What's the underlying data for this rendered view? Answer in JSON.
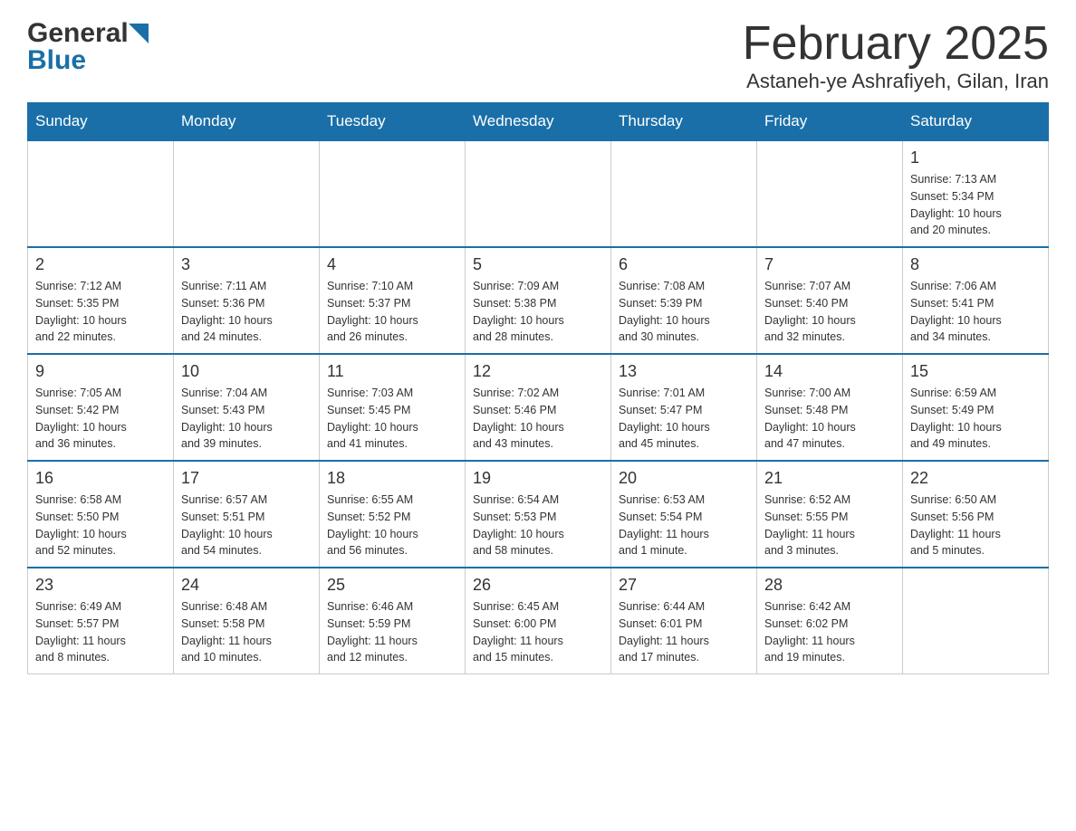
{
  "logo": {
    "general": "General",
    "blue": "Blue"
  },
  "title": "February 2025",
  "subtitle": "Astaneh-ye Ashrafiyeh, Gilan, Iran",
  "days_of_week": [
    "Sunday",
    "Monday",
    "Tuesday",
    "Wednesday",
    "Thursday",
    "Friday",
    "Saturday"
  ],
  "weeks": [
    {
      "cells": [
        {
          "day": "",
          "info": ""
        },
        {
          "day": "",
          "info": ""
        },
        {
          "day": "",
          "info": ""
        },
        {
          "day": "",
          "info": ""
        },
        {
          "day": "",
          "info": ""
        },
        {
          "day": "",
          "info": ""
        },
        {
          "day": "1",
          "info": "Sunrise: 7:13 AM\nSunset: 5:34 PM\nDaylight: 10 hours\nand 20 minutes."
        }
      ]
    },
    {
      "cells": [
        {
          "day": "2",
          "info": "Sunrise: 7:12 AM\nSunset: 5:35 PM\nDaylight: 10 hours\nand 22 minutes."
        },
        {
          "day": "3",
          "info": "Sunrise: 7:11 AM\nSunset: 5:36 PM\nDaylight: 10 hours\nand 24 minutes."
        },
        {
          "day": "4",
          "info": "Sunrise: 7:10 AM\nSunset: 5:37 PM\nDaylight: 10 hours\nand 26 minutes."
        },
        {
          "day": "5",
          "info": "Sunrise: 7:09 AM\nSunset: 5:38 PM\nDaylight: 10 hours\nand 28 minutes."
        },
        {
          "day": "6",
          "info": "Sunrise: 7:08 AM\nSunset: 5:39 PM\nDaylight: 10 hours\nand 30 minutes."
        },
        {
          "day": "7",
          "info": "Sunrise: 7:07 AM\nSunset: 5:40 PM\nDaylight: 10 hours\nand 32 minutes."
        },
        {
          "day": "8",
          "info": "Sunrise: 7:06 AM\nSunset: 5:41 PM\nDaylight: 10 hours\nand 34 minutes."
        }
      ]
    },
    {
      "cells": [
        {
          "day": "9",
          "info": "Sunrise: 7:05 AM\nSunset: 5:42 PM\nDaylight: 10 hours\nand 36 minutes."
        },
        {
          "day": "10",
          "info": "Sunrise: 7:04 AM\nSunset: 5:43 PM\nDaylight: 10 hours\nand 39 minutes."
        },
        {
          "day": "11",
          "info": "Sunrise: 7:03 AM\nSunset: 5:45 PM\nDaylight: 10 hours\nand 41 minutes."
        },
        {
          "day": "12",
          "info": "Sunrise: 7:02 AM\nSunset: 5:46 PM\nDaylight: 10 hours\nand 43 minutes."
        },
        {
          "day": "13",
          "info": "Sunrise: 7:01 AM\nSunset: 5:47 PM\nDaylight: 10 hours\nand 45 minutes."
        },
        {
          "day": "14",
          "info": "Sunrise: 7:00 AM\nSunset: 5:48 PM\nDaylight: 10 hours\nand 47 minutes."
        },
        {
          "day": "15",
          "info": "Sunrise: 6:59 AM\nSunset: 5:49 PM\nDaylight: 10 hours\nand 49 minutes."
        }
      ]
    },
    {
      "cells": [
        {
          "day": "16",
          "info": "Sunrise: 6:58 AM\nSunset: 5:50 PM\nDaylight: 10 hours\nand 52 minutes."
        },
        {
          "day": "17",
          "info": "Sunrise: 6:57 AM\nSunset: 5:51 PM\nDaylight: 10 hours\nand 54 minutes."
        },
        {
          "day": "18",
          "info": "Sunrise: 6:55 AM\nSunset: 5:52 PM\nDaylight: 10 hours\nand 56 minutes."
        },
        {
          "day": "19",
          "info": "Sunrise: 6:54 AM\nSunset: 5:53 PM\nDaylight: 10 hours\nand 58 minutes."
        },
        {
          "day": "20",
          "info": "Sunrise: 6:53 AM\nSunset: 5:54 PM\nDaylight: 11 hours\nand 1 minute."
        },
        {
          "day": "21",
          "info": "Sunrise: 6:52 AM\nSunset: 5:55 PM\nDaylight: 11 hours\nand 3 minutes."
        },
        {
          "day": "22",
          "info": "Sunrise: 6:50 AM\nSunset: 5:56 PM\nDaylight: 11 hours\nand 5 minutes."
        }
      ]
    },
    {
      "cells": [
        {
          "day": "23",
          "info": "Sunrise: 6:49 AM\nSunset: 5:57 PM\nDaylight: 11 hours\nand 8 minutes."
        },
        {
          "day": "24",
          "info": "Sunrise: 6:48 AM\nSunset: 5:58 PM\nDaylight: 11 hours\nand 10 minutes."
        },
        {
          "day": "25",
          "info": "Sunrise: 6:46 AM\nSunset: 5:59 PM\nDaylight: 11 hours\nand 12 minutes."
        },
        {
          "day": "26",
          "info": "Sunrise: 6:45 AM\nSunset: 6:00 PM\nDaylight: 11 hours\nand 15 minutes."
        },
        {
          "day": "27",
          "info": "Sunrise: 6:44 AM\nSunset: 6:01 PM\nDaylight: 11 hours\nand 17 minutes."
        },
        {
          "day": "28",
          "info": "Sunrise: 6:42 AM\nSunset: 6:02 PM\nDaylight: 11 hours\nand 19 minutes."
        },
        {
          "day": "",
          "info": ""
        }
      ]
    }
  ]
}
